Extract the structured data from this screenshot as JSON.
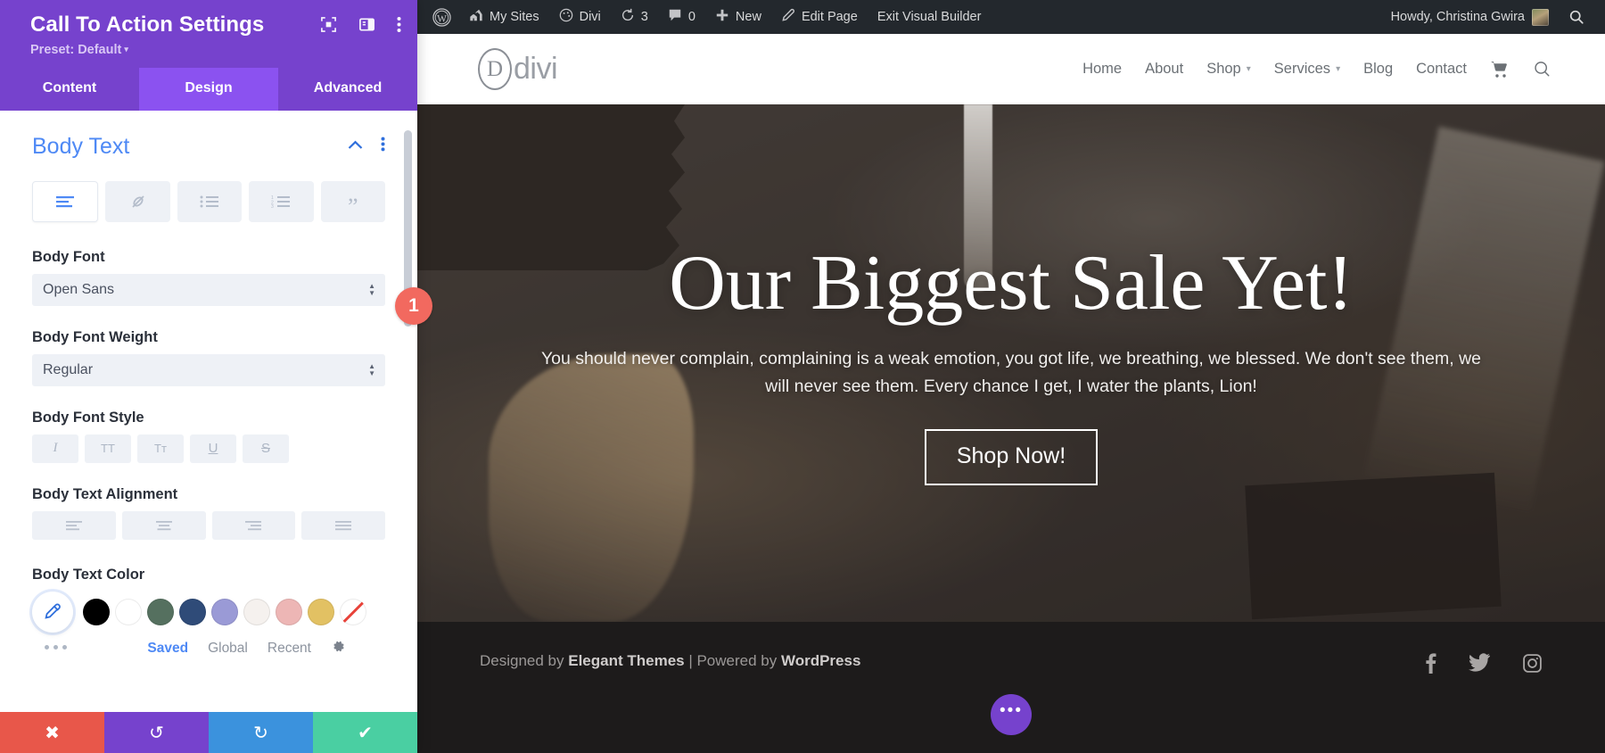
{
  "panel": {
    "title": "Call To Action Settings",
    "preset_label": "Preset: Default",
    "preset_caret": "▾",
    "head_icons": [
      "focus-icon",
      "layout-panel-icon",
      "kebab-menu-icon"
    ],
    "tabs": [
      {
        "label": "Content",
        "active": false
      },
      {
        "label": "Design",
        "active": true
      },
      {
        "label": "Advanced",
        "active": false
      }
    ],
    "section": {
      "title": "Body Text",
      "collapse_icon": "chevron-up-icon",
      "more_icon": "kebab-menu-icon",
      "text_type_buttons": [
        {
          "name": "paragraph-icon",
          "glyph": "≡",
          "active": true
        },
        {
          "name": "link-icon",
          "glyph": "⊘",
          "active": false
        },
        {
          "name": "unordered-list-icon",
          "glyph": "☰",
          "active": false
        },
        {
          "name": "ordered-list-icon",
          "glyph": "☷",
          "active": false
        },
        {
          "name": "blockquote-icon",
          "glyph": "”",
          "active": false
        }
      ],
      "body_font": {
        "label": "Body Font",
        "value": "Open Sans"
      },
      "body_font_weight": {
        "label": "Body Font Weight",
        "value": "Regular"
      },
      "body_font_style": {
        "label": "Body Font Style",
        "buttons": [
          {
            "name": "italic-icon",
            "glyph": "I"
          },
          {
            "name": "uppercase-icon",
            "glyph": "TT"
          },
          {
            "name": "small-caps-icon",
            "glyph": "Tᴛ"
          },
          {
            "name": "underline-icon",
            "glyph": "U"
          },
          {
            "name": "strikethrough-icon",
            "glyph": "S"
          }
        ]
      },
      "body_text_alignment": {
        "label": "Body Text Alignment",
        "buttons": [
          "align-left-icon",
          "align-center-icon",
          "align-right-icon",
          "align-justify-icon"
        ]
      },
      "body_text_color": {
        "label": "Body Text Color",
        "picker_icon": "eyedropper-icon",
        "swatches": [
          {
            "name": "swatch-black",
            "color": "#000000"
          },
          {
            "name": "swatch-white",
            "color": "#ffffff"
          },
          {
            "name": "swatch-green",
            "color": "#55705f"
          },
          {
            "name": "swatch-navy",
            "color": "#2f4b78"
          },
          {
            "name": "swatch-periwinkle",
            "color": "#9a9ad6"
          },
          {
            "name": "swatch-offwhite",
            "color": "#f5f1ee"
          },
          {
            "name": "swatch-pink",
            "color": "#edb6b5"
          },
          {
            "name": "swatch-gold",
            "color": "#e2c163"
          },
          {
            "name": "swatch-none",
            "color": "none"
          }
        ],
        "more_icon": "ellipsis-icon",
        "tabs": [
          {
            "label": "Saved",
            "active": true
          },
          {
            "label": "Global",
            "active": false
          },
          {
            "label": "Recent",
            "active": false
          }
        ],
        "settings_icon": "gear-icon"
      }
    },
    "footer_actions": [
      {
        "name": "discard-button",
        "glyph": "✖",
        "color": "#e8574a"
      },
      {
        "name": "undo-button",
        "glyph": "↺",
        "color": "#7642cd"
      },
      {
        "name": "redo-button",
        "glyph": "↻",
        "color": "#3b92dd"
      },
      {
        "name": "save-button",
        "glyph": "✔",
        "color": "#4acfa2"
      }
    ],
    "step_badge": "1"
  },
  "adminbar": {
    "logo_icon": "wordpress-icon",
    "items": [
      {
        "name": "my-sites",
        "icon": "buildings-icon",
        "label": "My Sites"
      },
      {
        "name": "divi",
        "icon": "divi-icon",
        "label": "Divi"
      },
      {
        "name": "updates",
        "icon": "update-icon",
        "label": "3"
      },
      {
        "name": "comments",
        "icon": "comment-icon",
        "label": "0"
      },
      {
        "name": "new",
        "icon": "plus-icon",
        "label": "New"
      },
      {
        "name": "edit-page",
        "icon": "pencil-icon",
        "label": "Edit Page"
      },
      {
        "name": "exit-visual-builder",
        "icon": "",
        "label": "Exit Visual Builder"
      }
    ],
    "howdy": "Howdy, Christina Gwira",
    "search_icon": "search-icon"
  },
  "site": {
    "logo": {
      "mark": "D",
      "text": "divi"
    },
    "nav": [
      {
        "label": "Home",
        "dropdown": false
      },
      {
        "label": "About",
        "dropdown": false
      },
      {
        "label": "Shop",
        "dropdown": true
      },
      {
        "label": "Services",
        "dropdown": true
      },
      {
        "label": "Blog",
        "dropdown": false
      },
      {
        "label": "Contact",
        "dropdown": false
      }
    ],
    "nav_icons": [
      "cart-icon",
      "search-icon"
    ],
    "hero": {
      "title": "Our Biggest Sale Yet!",
      "subtitle": "You should never complain, complaining is a weak emotion, you got life, we breathing, we blessed. We don't see them, we will never see them. Every chance I get, I water the plants, Lion!",
      "button": "Shop Now!"
    },
    "footer": {
      "prefix": "Designed by ",
      "brand1": "Elegant Themes",
      "middle": " | Powered by ",
      "brand2": "WordPress",
      "social": [
        "facebook-icon",
        "twitter-icon",
        "instagram-icon"
      ],
      "fab": "•••"
    }
  }
}
